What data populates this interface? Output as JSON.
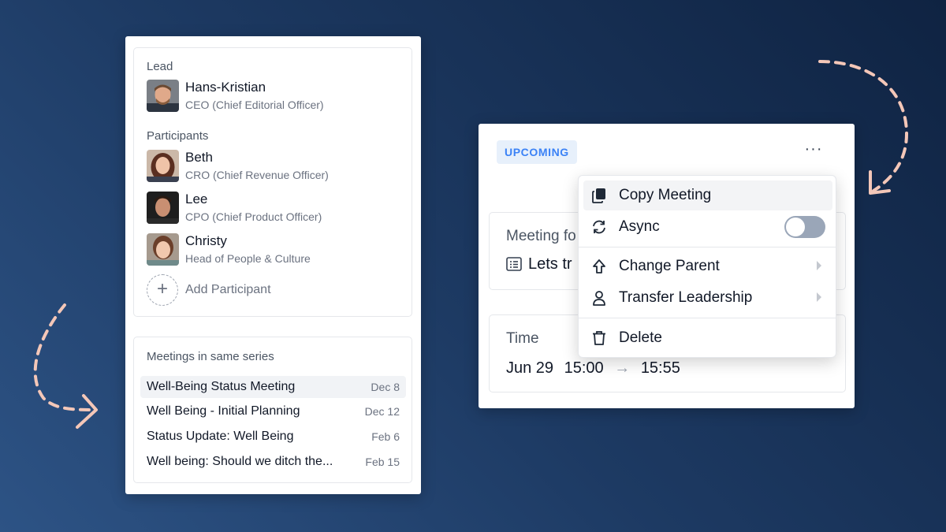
{
  "lead": {
    "label": "Lead",
    "person": {
      "name": "Hans-Kristian",
      "role": "CEO (Chief Editorial Officer)"
    }
  },
  "participants": {
    "label": "Participants",
    "people": [
      {
        "name": "Beth",
        "role": "CRO (Chief Revenue Officer)"
      },
      {
        "name": "Lee",
        "role": "CPO (Chief Product Officer)"
      },
      {
        "name": "Christy",
        "role": "Head of People & Culture"
      }
    ],
    "add_label": "Add Participant"
  },
  "series": {
    "title": "Meetings in same series",
    "meetings": [
      {
        "name": "Well-Being Status Meeting",
        "date": "Dec 8"
      },
      {
        "name": "Well Being - Initial Planning",
        "date": "Dec 12"
      },
      {
        "name": "Status Update: Well Being",
        "date": "Feb 6"
      },
      {
        "name": "Well being: Should we ditch the...",
        "date": "Feb 15"
      }
    ]
  },
  "meeting": {
    "status_badge": "UPCOMING",
    "more_label": "···",
    "focus_label": "Meeting fo",
    "focus_text": "Lets tr",
    "time_label": "Time",
    "date": "Jun 29",
    "start": "15:00",
    "end": "15:55"
  },
  "menu": {
    "items": [
      {
        "label": "Copy Meeting",
        "icon": "copy-icon"
      },
      {
        "label": "Async",
        "icon": "refresh-icon",
        "toggle": false
      },
      {
        "label": "Change Parent",
        "icon": "arrow-up-icon"
      },
      {
        "label": "Transfer Leadership",
        "icon": "user-icon"
      },
      {
        "label": "Delete",
        "icon": "trash-icon"
      }
    ]
  },
  "colors": {
    "background_top": "#0f2342",
    "background_bottom": "#2d5385",
    "badge_text": "#3b82f6",
    "decor_arrow": "#f4c7b8"
  }
}
